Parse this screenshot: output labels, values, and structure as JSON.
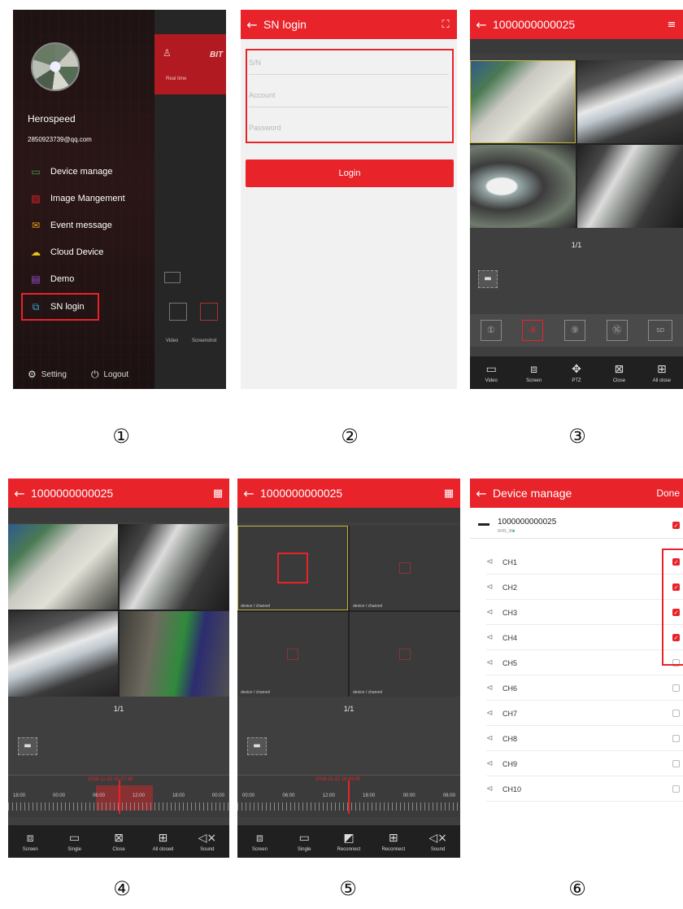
{
  "markers": [
    "①",
    "②",
    "③",
    "④",
    "⑤",
    "⑥"
  ],
  "panel1": {
    "username": "Herospeed",
    "email": "2850923739@qq.com",
    "menu": [
      {
        "icon": "▭",
        "label": "Device manage"
      },
      {
        "icon": "▨",
        "label": "Image Mangement"
      },
      {
        "icon": "✉",
        "label": "Event message"
      },
      {
        "icon": "☁",
        "label": "Cloud Device"
      },
      {
        "icon": "▤",
        "label": "Demo"
      },
      {
        "icon": "⧉",
        "label": "SN login"
      }
    ],
    "setting_label": "Setting",
    "logout_label": "Logout",
    "behind_tab_label": "Real time",
    "behind_brand": "BIT",
    "behind_tools": [
      "Video",
      "Screenshot"
    ]
  },
  "panel2": {
    "title": "SN login",
    "fields": [
      {
        "placeholder": "S/N"
      },
      {
        "placeholder": "Account"
      },
      {
        "placeholder": "Password"
      }
    ],
    "login_label": "Login"
  },
  "panel3": {
    "title": "1000000000025",
    "page": "1/1",
    "layout_buttons": [
      "①",
      "④",
      "⑨",
      "⑯",
      "SD"
    ],
    "tools": [
      {
        "icon": "▭",
        "label": "Video"
      },
      {
        "icon": "⧈",
        "label": "Screen"
      },
      {
        "icon": "✥",
        "label": "PTZ"
      },
      {
        "icon": "⊠",
        "label": "Close"
      },
      {
        "icon": "⊞",
        "label": "All close"
      }
    ]
  },
  "panel4": {
    "title": "1000000000025",
    "page": "1/1",
    "timestamp": "2018-11-22 15:27:48",
    "time_labels": [
      "18:00",
      "00:00",
      "06:00",
      "12:00",
      "18:00",
      "00:00"
    ],
    "tools": [
      {
        "icon": "⧈",
        "label": "Screen"
      },
      {
        "icon": "▭",
        "label": "Single"
      },
      {
        "icon": "⊠",
        "label": "Close"
      },
      {
        "icon": "⊞",
        "label": "All closed"
      },
      {
        "icon": "◁×",
        "label": "Sound"
      }
    ]
  },
  "panel5": {
    "title": "1000000000025",
    "page": "1/1",
    "timestamp": "2018-11-22 16:45:00",
    "time_labels": [
      "00:00",
      "06:00",
      "12:00",
      "18:00",
      "00:00",
      "06:00"
    ],
    "cell_tag": "device / channel",
    "tools": [
      {
        "icon": "⧈",
        "label": "Screen"
      },
      {
        "icon": "▭",
        "label": "Single"
      },
      {
        "icon": "◩",
        "label": "Reconnect"
      },
      {
        "icon": "⊞",
        "label": "Reconnect"
      },
      {
        "icon": "◁×",
        "label": "Sound"
      }
    ]
  },
  "panel6": {
    "title": "Device manage",
    "done_label": "Done",
    "device_sn": "1000000000025",
    "device_model": "NVR_36",
    "channels": [
      {
        "label": "CH1",
        "checked": true
      },
      {
        "label": "CH2",
        "checked": true
      },
      {
        "label": "CH3",
        "checked": true
      },
      {
        "label": "CH4",
        "checked": true
      },
      {
        "label": "CH5",
        "checked": false
      },
      {
        "label": "CH6",
        "checked": false
      },
      {
        "label": "CH7",
        "checked": false
      },
      {
        "label": "CH8",
        "checked": false
      },
      {
        "label": "CH9",
        "checked": false
      },
      {
        "label": "CH10",
        "checked": false
      }
    ]
  },
  "colors": {
    "accent": "#e8232a",
    "dark_bg": "#3f3f3f",
    "status_online": "#2fa84f"
  }
}
